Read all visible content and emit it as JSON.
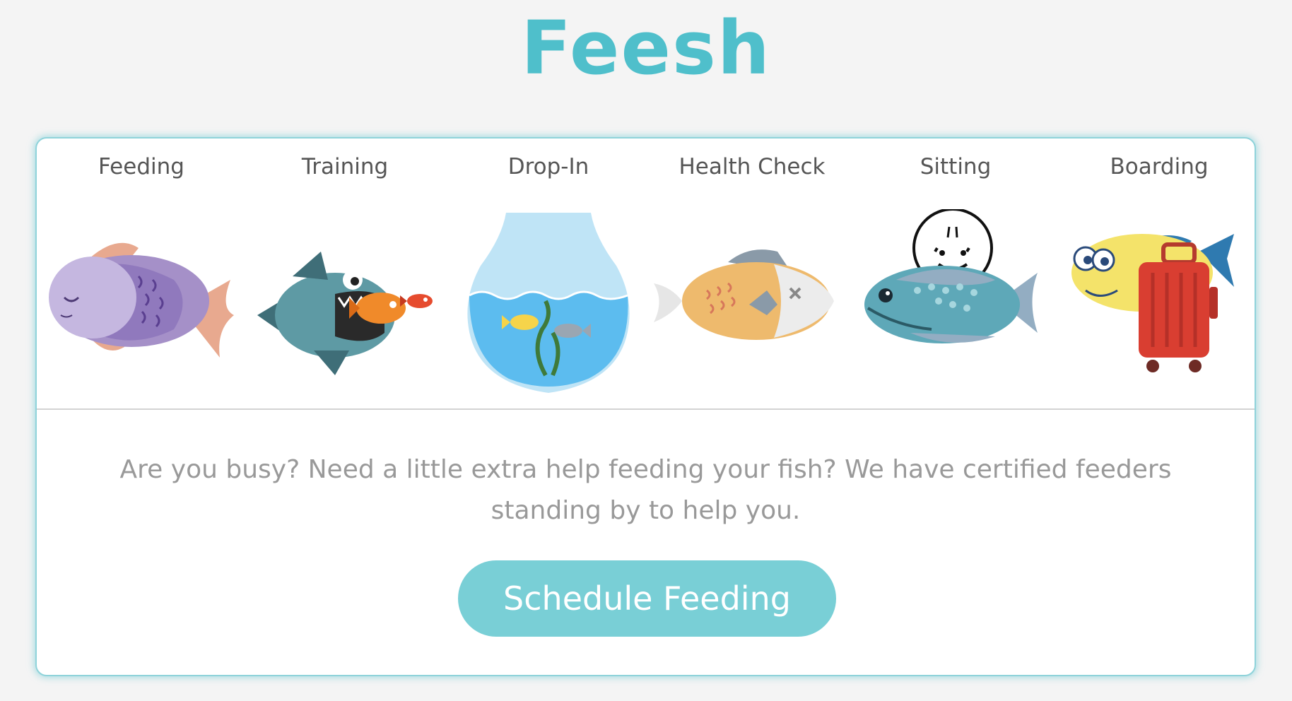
{
  "brand": {
    "name": "Feesh",
    "color": "#4fbfcb"
  },
  "tabs": [
    {
      "label": "Feeding",
      "icon": "sleeping-fish-icon"
    },
    {
      "label": "Training",
      "icon": "big-fish-chasing-icon"
    },
    {
      "label": "Drop-In",
      "icon": "fishbowl-icon"
    },
    {
      "label": "Health Check",
      "icon": "fish-skeleton-icon"
    },
    {
      "label": "Sitting",
      "icon": "baby-fish-icon"
    },
    {
      "label": "Boarding",
      "icon": "fish-suitcase-icon"
    }
  ],
  "content": {
    "description": "Are you busy? Need a little extra help feeding your fish? We have certified feeders standing by to help you.",
    "button_label": "Schedule Feeding"
  },
  "colors": {
    "accent": "#79cfd6",
    "card_border": "#8fd3da",
    "background": "#f4f4f4"
  }
}
